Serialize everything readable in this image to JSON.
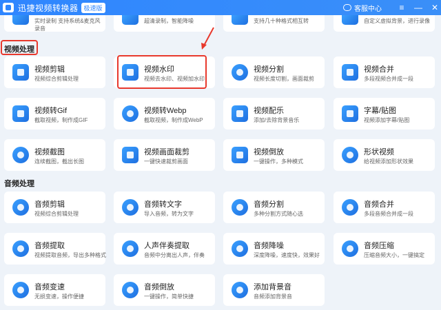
{
  "app": {
    "title": "迅捷视频转换器",
    "edition": "极速版",
    "support_label": "客服中心"
  },
  "window_controls": {
    "menu": "≡",
    "minimize": "—",
    "close": "✕"
  },
  "top_partial": [
    {
      "desc": "实时录制 支持系统&麦克风录音",
      "icon": "record-icon"
    },
    {
      "desc": "超清录制，智能降噪",
      "icon": "screen-record-icon"
    },
    {
      "desc": "支持几十种格式相互转",
      "icon": "convert-icon"
    },
    {
      "desc": "自定义虚拟背景，进行录像",
      "icon": "virtual-bg-icon"
    }
  ],
  "sections": [
    {
      "title": "视频处理",
      "cards": [
        {
          "name": "视频剪辑",
          "desc": "视频综合剪辑处理",
          "icon": "video-edit-icon"
        },
        {
          "name": "视频水印",
          "desc": "视频去水印、视频加水印",
          "icon": "video-watermark-icon"
        },
        {
          "name": "视频分割",
          "desc": "视频长度切割，画面裁剪",
          "icon": "video-split-icon"
        },
        {
          "name": "视频合并",
          "desc": "多段视频合并成一段",
          "icon": "video-merge-icon"
        },
        {
          "name": "视频转Gif",
          "desc": "截取视频，制作成GIF",
          "icon": "gif-icon"
        },
        {
          "name": "视频转Webp",
          "desc": "截取视频，制作成WebP",
          "icon": "webp-icon"
        },
        {
          "name": "视频配乐",
          "desc": "添加/去除背景音乐",
          "icon": "video-music-icon"
        },
        {
          "name": "字幕/贴图",
          "desc": "视频添加字幕/贴图",
          "icon": "subtitle-sticker-icon"
        },
        {
          "name": "视频截图",
          "desc": "连续截图，截出长图",
          "icon": "screenshot-icon"
        },
        {
          "name": "视频画面裁剪",
          "desc": "一键快速裁剪画面",
          "icon": "crop-icon"
        },
        {
          "name": "视频倒放",
          "desc": "一键操作，多种模式",
          "icon": "video-reverse-icon"
        },
        {
          "name": "形状视频",
          "desc": "给视频添加形状效果",
          "icon": "shape-video-icon"
        }
      ]
    },
    {
      "title": "音频处理",
      "cards": [
        {
          "name": "音频剪辑",
          "desc": "视频综合剪辑处理",
          "icon": "audio-edit-icon"
        },
        {
          "name": "音频转文字",
          "desc": "导入音频，转为文字",
          "icon": "audio-to-text-icon"
        },
        {
          "name": "音频分割",
          "desc": "多种分割方式随心选",
          "icon": "audio-split-icon"
        },
        {
          "name": "音频合并",
          "desc": "多段音频合并成一段",
          "icon": "audio-merge-icon"
        },
        {
          "name": "音频提取",
          "desc": "视频提取音频，导出多种格式",
          "icon": "audio-extract-icon"
        },
        {
          "name": "人声伴奏提取",
          "desc": "音频中分离出人声，伴奏",
          "icon": "vocal-extract-icon"
        },
        {
          "name": "音频降噪",
          "desc": "深度降噪，速度快，效果好",
          "icon": "denoise-icon"
        },
        {
          "name": "音频压缩",
          "desc": "压缩音频大小，一键搞定",
          "icon": "audio-compress-icon"
        },
        {
          "name": "音频变速",
          "desc": "无损变速，操作便捷",
          "icon": "audio-speed-icon"
        },
        {
          "name": "音频倒放",
          "desc": "一键操作，简单快捷",
          "icon": "audio-reverse-icon"
        },
        {
          "name": "添加背景音",
          "desc": "音频添加背景音",
          "icon": "add-bg-sound-icon"
        }
      ]
    }
  ],
  "colors": {
    "accent": "#2f86ff",
    "highlight": "#e8382c",
    "background": "#eef3f9"
  }
}
